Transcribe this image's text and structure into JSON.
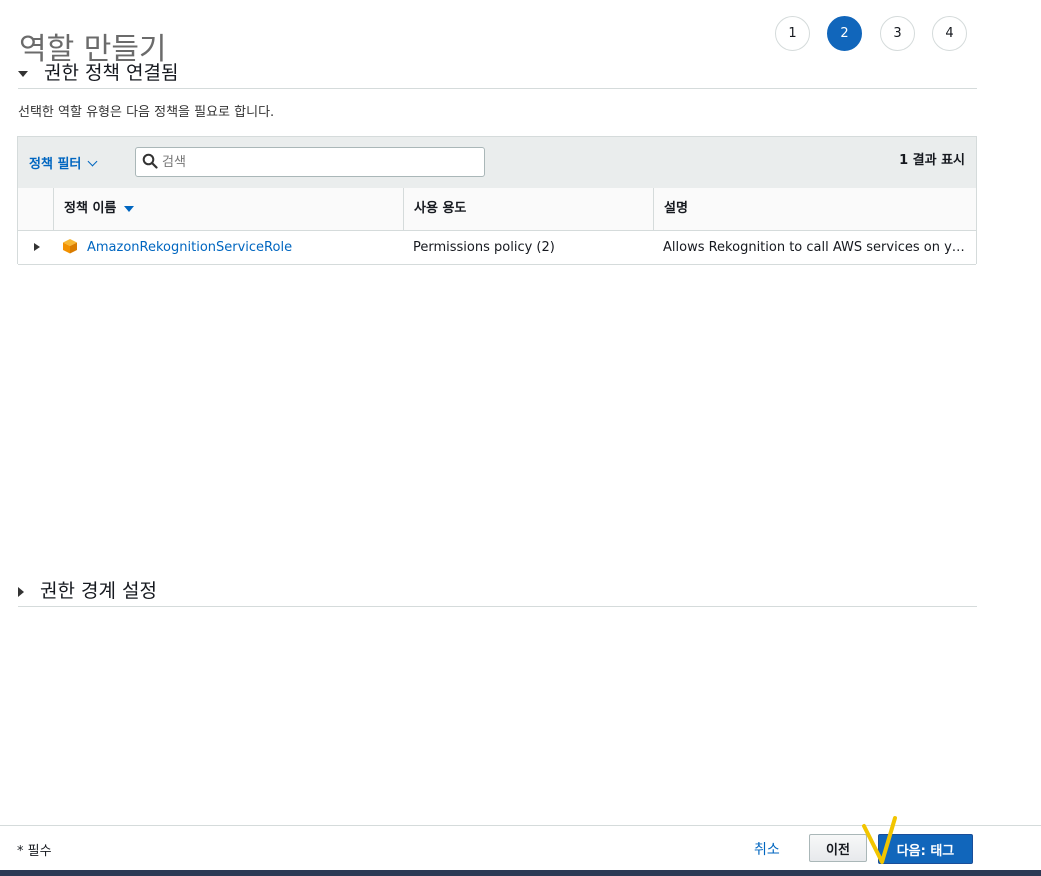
{
  "page": {
    "title": "역할 만들기"
  },
  "steps": [
    {
      "label": "1",
      "active": false
    },
    {
      "label": "2",
      "active": true
    },
    {
      "label": "3",
      "active": false
    },
    {
      "label": "4",
      "active": false
    }
  ],
  "policies_section": {
    "title": "권한 정책 연결됨",
    "description": "선택한 역할 유형은 다음 정책을 필요로 합니다.",
    "filter_label": "정책 필터",
    "search_placeholder": "검색",
    "result_count": "1 결과 표시",
    "columns": [
      "정책 이름",
      "사용 용도",
      "설명"
    ],
    "rows": [
      {
        "name": "AmazonRekognitionServiceRole",
        "usage": "Permissions policy (2)",
        "description": "Allows Rekognition to call AWS services on yo..."
      }
    ]
  },
  "boundary_section": {
    "title": "권한 경계 설정"
  },
  "footer": {
    "required_note": "* 필수",
    "cancel_label": "취소",
    "prev_label": "이전",
    "next_label": "다음: 태그"
  },
  "colors": {
    "primary": "#1166bb",
    "link": "#0066c0",
    "annotation": "#f2c500",
    "policy_icon": "#f29100"
  },
  "icons": [
    "search-icon",
    "policy-box-icon",
    "caret-down-icon",
    "caret-right-icon",
    "sort-down-icon"
  ]
}
